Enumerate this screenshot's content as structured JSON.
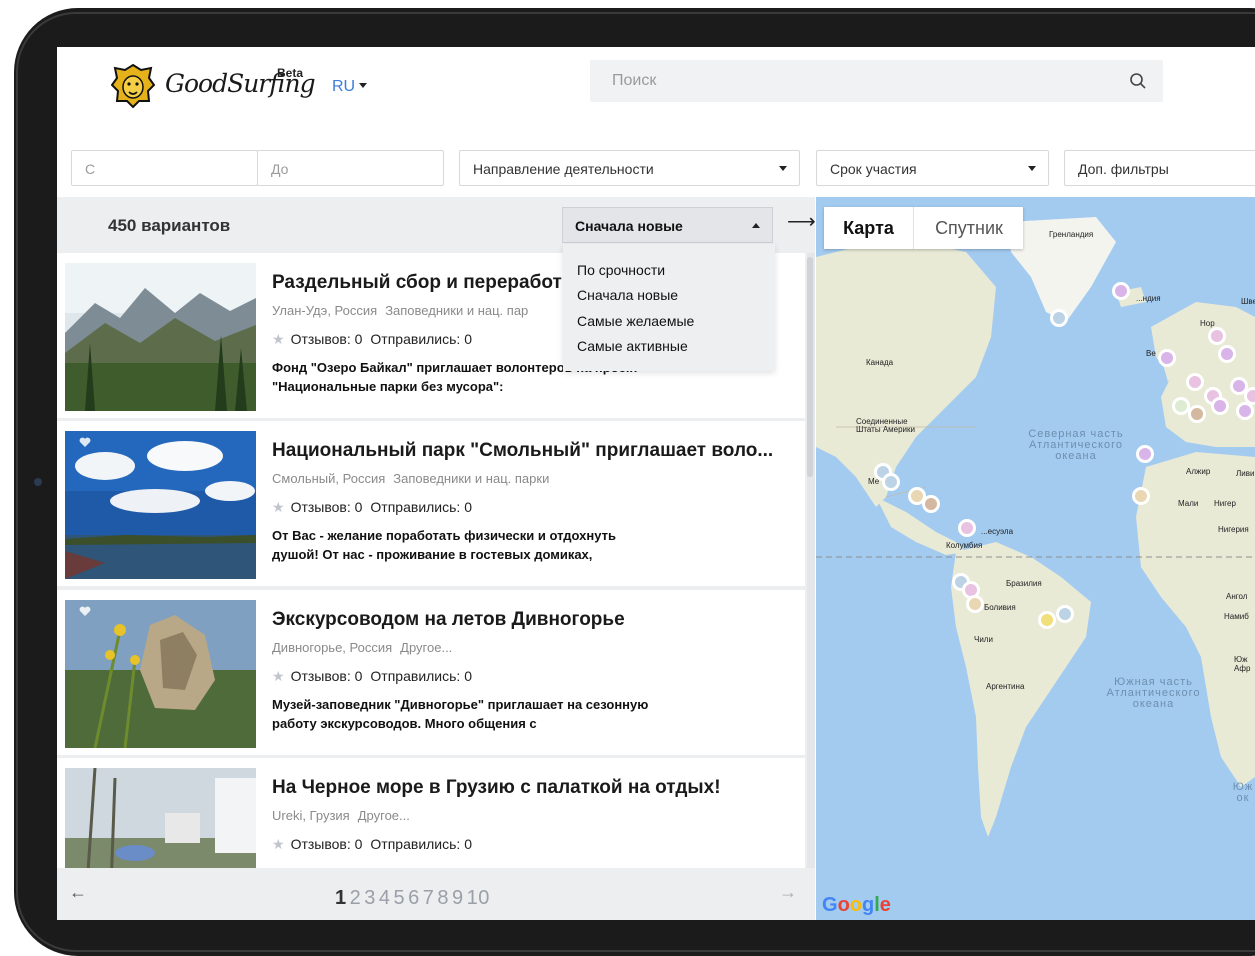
{
  "header": {
    "brand": "GoodSurfing",
    "beta": "Beta",
    "lang": "RU",
    "search_placeholder": "Поиск"
  },
  "filters": {
    "from_placeholder": "С",
    "to_placeholder": "До",
    "activity": "Направление деятельности",
    "duration": "Срок участия",
    "more": "Доп. фильтры"
  },
  "list": {
    "count": "450 вариантов",
    "sort_selected": "Сначала новые",
    "sort_options": [
      "По срочности",
      "Сначала новые",
      "Самые желаемые",
      "Самые активные"
    ],
    "items": [
      {
        "title": "Раздельный сбор и переработка",
        "city": "Улан-Удэ, Россия",
        "category": "Заповедники и нац. пар",
        "reviews": "Отзывов: 0",
        "went": "Отправились: 0",
        "desc": "Фонд \"Озеро Байкал\" приглашает волонтеров на проект \"Национальные парки без мусора\":"
      },
      {
        "title": "Национальный парк \"Смольный\" приглашает воло...",
        "city": "Смольный, Россия",
        "category": "Заповедники и нац. парки",
        "reviews": "Отзывов: 0",
        "went": "Отправились: 0",
        "desc": "От Вас - желание поработать физически и отдохнуть душой! От нас - проживание в гостевых домиках,"
      },
      {
        "title": "Экскурсоводом на летов Дивногорье",
        "city": "Дивногорье, Россия",
        "category": "Другое...",
        "reviews": "Отзывов: 0",
        "went": "Отправились: 0",
        "desc": "Музей-заповедник \"Дивногорье\" приглашает на сезонную работу экскурсоводов. Много общения с"
      },
      {
        "title": "На Черное море в Грузию с палаткой на отдых!",
        "city": "Ureki, Грузия",
        "category": "Другое...",
        "reviews": "Отзывов: 0",
        "went": "Отправились: 0",
        "desc": ""
      }
    ]
  },
  "pager": {
    "prev": "←",
    "next": "→",
    "pages": [
      "1",
      "2",
      "3",
      "4",
      "5",
      "6",
      "7",
      "8",
      "9",
      "10"
    ],
    "current": "1"
  },
  "map": {
    "map_button": "Карта",
    "satellite_button": "Спутник",
    "labels": {
      "greenland": "Гренландия",
      "canada": "Канада",
      "usa": "Соединенные Штаты Америки",
      "north_atlantic": "Северная часть Атлантического океана",
      "south_atlantic": "Южная часть Атлантического океана",
      "colombia": "Колумбия",
      "venezuela": "...есуэла",
      "brazil": "Бразилия",
      "bolivia": "Боливия",
      "chile": "Чили",
      "argentina": "Аргентина",
      "algeria": "Алжир",
      "libya": "Ливи",
      "mali": "Мали",
      "niger": "Нигер",
      "nigeria": "Нигерия",
      "angola": "Ангол",
      "namibia": "Намиб",
      "south_africa": "Юж Афр",
      "mexico": "Ме",
      "sweden": "Шве",
      "norway": "Нор",
      "uk": "Ве",
      "iceland": "...ндия",
      "ocean_partial": "Юж ок"
    },
    "attribution": "Google"
  },
  "colors": {
    "accent": "#3b7dd8",
    "panel": "#eceef0",
    "water": "#a3cbf0",
    "land": "#ececd9"
  }
}
